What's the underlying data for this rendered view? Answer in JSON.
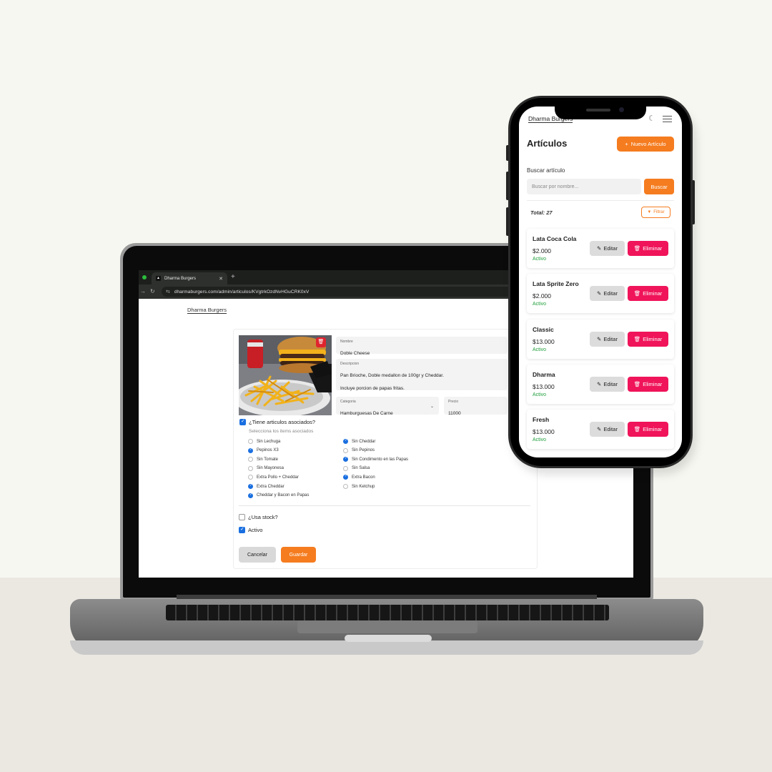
{
  "laptop": {
    "browser": {
      "tab_title": "Dharma Burgers",
      "tab_close": "✕",
      "new_tab": "+",
      "url": "dharmaburgers.com/admin/articulos/KVgtrkOzdNvHGuCRK0xV"
    },
    "app": {
      "brand": "Dharma Burgers",
      "form": {
        "nombre": {
          "label": "Nombre",
          "value": "Doble Cheese"
        },
        "descripcion": {
          "label": "Descripcion",
          "value": "Pan Brioche, Doble medallon de 100gr y Cheddar.\nIncluye porcion de papas fritas."
        },
        "categoria": {
          "label": "Categoria",
          "value": "Hamburguesas De Carne"
        },
        "precio": {
          "label": "Precio",
          "value": "11000"
        },
        "associated_question": "¿Tiene articulos asociados?",
        "associated_checked": true,
        "associated_hint": "Selecciona los items asociados",
        "options_left": [
          {
            "label": "Sin Lechuga",
            "checked": false
          },
          {
            "label": "Pepinos X3",
            "checked": true
          },
          {
            "label": "Sin Tomate",
            "checked": false
          },
          {
            "label": "Sin Mayonesa",
            "checked": false
          },
          {
            "label": "Extra Pollo + Cheddar",
            "checked": false
          },
          {
            "label": "Extra Cheddar",
            "checked": true
          },
          {
            "label": "Cheddar y Bacon en Papas",
            "checked": true
          }
        ],
        "options_right": [
          {
            "label": "Sin Cheddar",
            "checked": true
          },
          {
            "label": "Sin Pepinos",
            "checked": false
          },
          {
            "label": "Sin Condimento en las Papas",
            "checked": true
          },
          {
            "label": "Sin Salsa",
            "checked": false
          },
          {
            "label": "Extra Bacon",
            "checked": true
          },
          {
            "label": "Sin Ketchup",
            "checked": false
          }
        ],
        "uses_stock_label": "¿Usa stock?",
        "uses_stock_checked": false,
        "active_label": "Activo",
        "active_checked": true,
        "cancel_label": "Cancelar",
        "save_label": "Guardar"
      }
    }
  },
  "phone": {
    "brand": "Dharma Burgers",
    "title": "Artículos",
    "new_button": "Nuevo Artículo",
    "search_label": "Buscar artículo",
    "search_placeholder": "Buscar por nombre...",
    "search_button": "Buscar",
    "total": "Total: 27",
    "filter_button": "Filtrar",
    "edit_label": "Editar",
    "delete_label": "Eliminar",
    "articles": [
      {
        "name": "Lata Coca Cola",
        "price": "$2.000",
        "status": "Activo"
      },
      {
        "name": "Lata Sprite Zero",
        "price": "$2.000",
        "status": "Activo"
      },
      {
        "name": "Classic",
        "price": "$13.000",
        "status": "Activo"
      },
      {
        "name": "Dharma",
        "price": "$13.000",
        "status": "Activo"
      },
      {
        "name": "Fresh",
        "price": "$13.000",
        "status": "Activo"
      }
    ]
  },
  "colors": {
    "accent": "#f57c1f",
    "danger": "#f0145a",
    "checkbox": "#1a6fe0",
    "active_status": "#1e9e3a"
  },
  "icons": [
    "trash-icon",
    "pencil-icon",
    "plus-icon",
    "filter-icon",
    "moon-icon",
    "menu-icon",
    "reload-icon",
    "site-info-icon",
    "chevron-down-icon"
  ]
}
